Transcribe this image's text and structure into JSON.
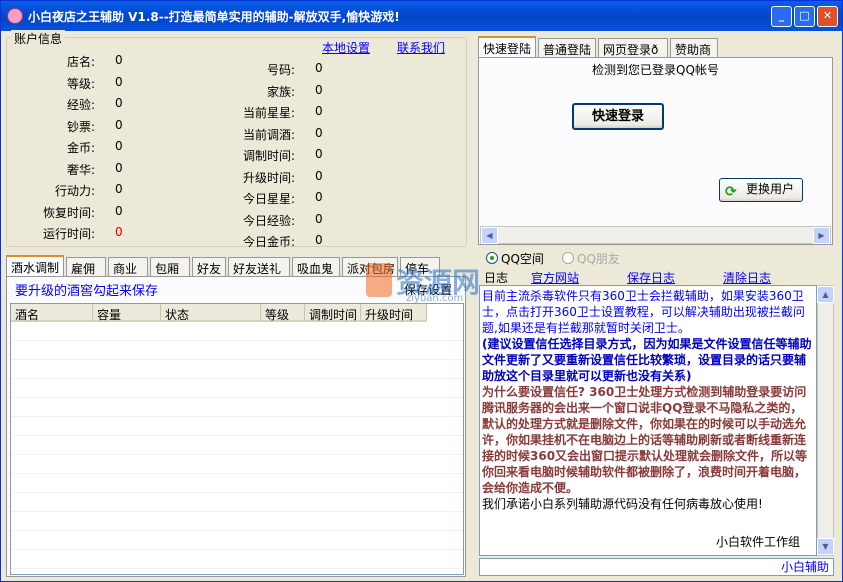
{
  "window": {
    "title": "小白夜店之王辅助 V1.8--打造最简单实用的辅助-解放双手,愉快游戏!"
  },
  "account": {
    "group_title": "账户信息",
    "local_settings": "本地设置",
    "contact_us": "联系我们",
    "left": [
      {
        "label": "店名:",
        "value": "0"
      },
      {
        "label": "等级:",
        "value": "0"
      },
      {
        "label": "经验:",
        "value": "0"
      },
      {
        "label": "钞票:",
        "value": "0"
      },
      {
        "label": "金币:",
        "value": "0"
      },
      {
        "label": "奢华:",
        "value": "0"
      },
      {
        "label": "行动力:",
        "value": "0"
      },
      {
        "label": "恢复时间:",
        "value": "0"
      },
      {
        "label": "运行时间:",
        "value": "0"
      }
    ],
    "right": [
      {
        "label": "号码:",
        "value": "0"
      },
      {
        "label": "家族:",
        "value": "0"
      },
      {
        "label": "当前星星:",
        "value": "0"
      },
      {
        "label": "当前调酒:",
        "value": "0"
      },
      {
        "label": "调制时间:",
        "value": "0"
      },
      {
        "label": "升级时间:",
        "value": "0"
      },
      {
        "label": "今日星星:",
        "value": "0"
      },
      {
        "label": "今日经验:",
        "value": "0"
      },
      {
        "label": "今日金币:",
        "value": "0"
      }
    ],
    "run_time_color": "#e00000"
  },
  "left_tabs": [
    "酒水调制",
    "雇佣",
    "商业",
    "包厢",
    "好友",
    "好友送礼",
    "吸血鬼",
    "派对包房",
    "停车"
  ],
  "wine": {
    "hint": "要升级的酒窖勾起来保存",
    "save_button": "保存设置",
    "columns": [
      "酒名",
      "容量",
      "状态",
      "等级",
      "调制时间",
      "升级时间"
    ]
  },
  "login_tabs": [
    "快速登陆",
    "普通登陆",
    "网页登录ð",
    "赞助商"
  ],
  "login": {
    "detect_text": "检测到您已登录QQ帐号",
    "quick_login": "快速登录",
    "switch_user": "更换用户"
  },
  "radio": {
    "qq_space": "QQ空间",
    "qq_friend": "QQ朋友"
  },
  "log": {
    "tab_label": "日志",
    "official_site": "官方网站",
    "save_log": "保存日志",
    "clear_log": "清除日志",
    "lines_blue": "目前主流杀毒软件只有360卫士会拦截辅助，如果安装360卫士，点击打开360卫士设置教程，可以解决辅助出现被拦截问题,如果还是有拦截那就暂时关闭卫士。",
    "lines_dblue": "(建议设置信任选择目录方式，因为如果是文件设置信任等辅助文件更新了又要重新设置信任比较繁琐，设置目录的话只要辅助放这个目录里就可以更新也没有关系)",
    "lines_brown": "为什么要设置信任? 360卫士处理方式检测到辅助登录要访问腾讯服务器的会出来一个窗口说非QQ登录不马隐私之类的，默认的处理方式就是删除文件，你如果在的时候可以手动选允许，你如果挂机不在电脑边上的话等辅助刷新或者断线重新连接的时候360又会出窗口提示默认处理就会删除文件，所以等你回来看电脑时候辅助软件都被删除了，浪费时间开着电脑，会给你造成不便。",
    "line_black": "我们承诺小白系列辅助源代码没有任何病毒放心使用!",
    "signature": "小白软件工作组"
  },
  "watermark": {
    "big": "资源网",
    "small": "ziyuan.com"
  },
  "footer": {
    "brand": "小白辅助"
  }
}
